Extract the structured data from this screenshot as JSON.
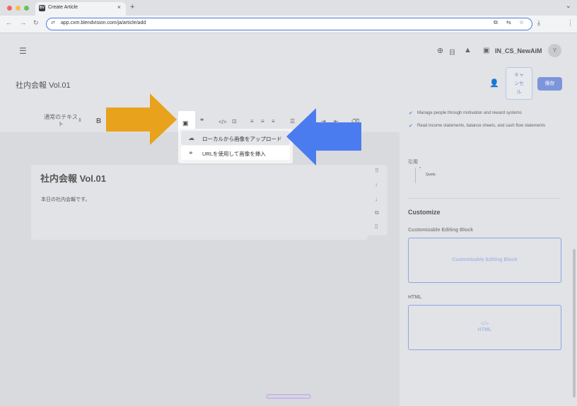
{
  "browser": {
    "tab_title": "Create Article",
    "tab_favicon": "BV",
    "tab_close": "×",
    "new_tab": "+",
    "url": "app.cxm.blendvision.com/ja/article/add",
    "colors": {
      "red": "#ed6a5e",
      "yellow": "#f5bf4f",
      "green": "#61c554"
    }
  },
  "header": {
    "menu_icon": "☰",
    "globe_icon": "🌐",
    "language": "日",
    "bell_icon": "🔔",
    "user_icon": "▣",
    "username": "IN_CS_NewAiM",
    "avatar_initial": "Y"
  },
  "page": {
    "title": "社内会報 Vol.01",
    "cancel_label": "キャンセル",
    "save_label": "保存"
  },
  "toolbar": {
    "text_style": "通常のテキスト",
    "bold": "B",
    "image_icon": "▣",
    "quote": "❞",
    "code": "</>",
    "code_block": "⊡",
    "align_left": "≡",
    "align_center": "≡",
    "align_right": "≡",
    "list": "☰"
  },
  "image_menu": {
    "items": [
      {
        "label": "ローカルから画像をアップロード",
        "icon": "cloud-upload-icon"
      },
      {
        "label": "URLを使用して画像を挿入",
        "icon": "link-icon"
      }
    ]
  },
  "article": {
    "heading": "社内会報 Vol.01",
    "body": "本日の社内会報です。"
  },
  "side_tools": {
    "drag": "⠿",
    "up": "↑",
    "down": "↓",
    "copy": "⧉",
    "delete": "🗑"
  },
  "panel": {
    "features": [
      "Manage people through motivation and reward systems",
      "Read income statements, balance sheets, and cash flow statements"
    ],
    "quote_label": "引用",
    "quote_text": "Quote.",
    "customize_title": "Customize",
    "custom_block_label": "Customizable Editing Block",
    "custom_block_text": "Customizable Editing Block",
    "html_label": "HTML",
    "html_code": "</>",
    "html_text": "HTML"
  },
  "annotations": {
    "arrow_left_color": "#e8a21b",
    "arrow_right_color": "#4a7cf0"
  }
}
